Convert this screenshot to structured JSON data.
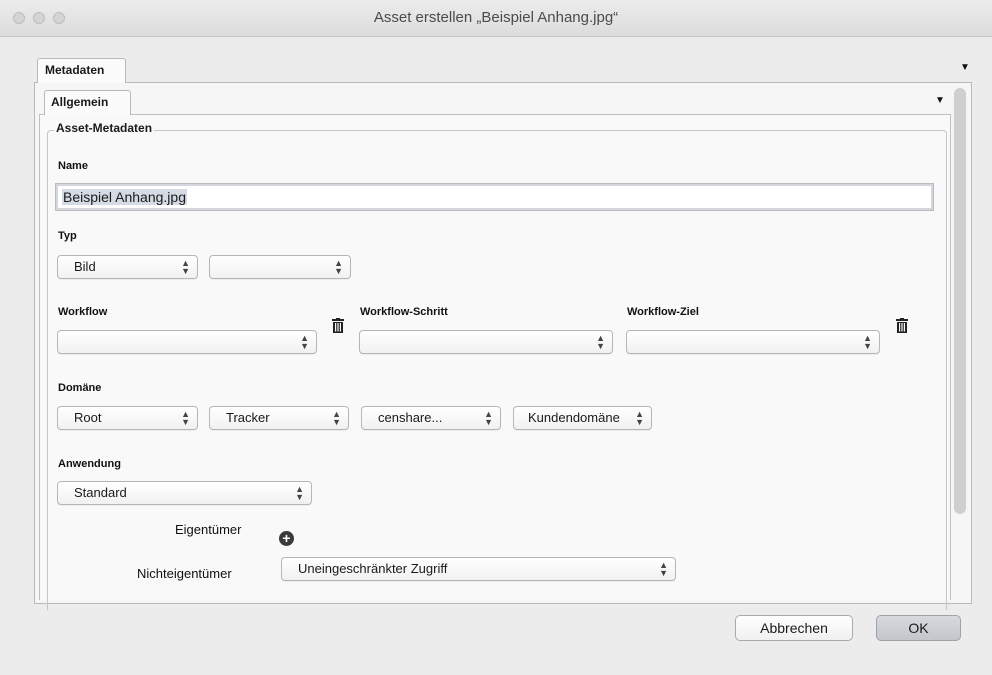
{
  "window": {
    "title": "Asset erstellen „Beispiel Anhang.jpg“"
  },
  "tabs": {
    "outer": "Metadaten",
    "inner": "Allgemein"
  },
  "section": {
    "legend": "Asset-Metadaten"
  },
  "name": {
    "label": "Name",
    "value": "Beispiel Anhang.jpg"
  },
  "typ": {
    "label": "Typ",
    "select1": "Bild",
    "select2": ""
  },
  "workflow": {
    "label": "Workflow",
    "value": "",
    "step_label": "Workflow-Schritt",
    "step_value": "",
    "target_label": "Workflow-Ziel",
    "target_value": ""
  },
  "domain": {
    "label": "Domäne",
    "values": [
      "Root",
      "Tracker",
      "censhare...",
      "Kundendomäne"
    ]
  },
  "application": {
    "label": "Anwendung",
    "value": "Standard"
  },
  "owner": {
    "label": "Eigentümer"
  },
  "non_owner": {
    "label": "Nichteigentümer",
    "value": "Uneingeschränkter Zugriff"
  },
  "buttons": {
    "cancel": "Abbrechen",
    "ok": "OK"
  },
  "icons": [
    "trash-icon",
    "plus-icon",
    "chevron-down-icon",
    "updown-chevron-icon"
  ]
}
